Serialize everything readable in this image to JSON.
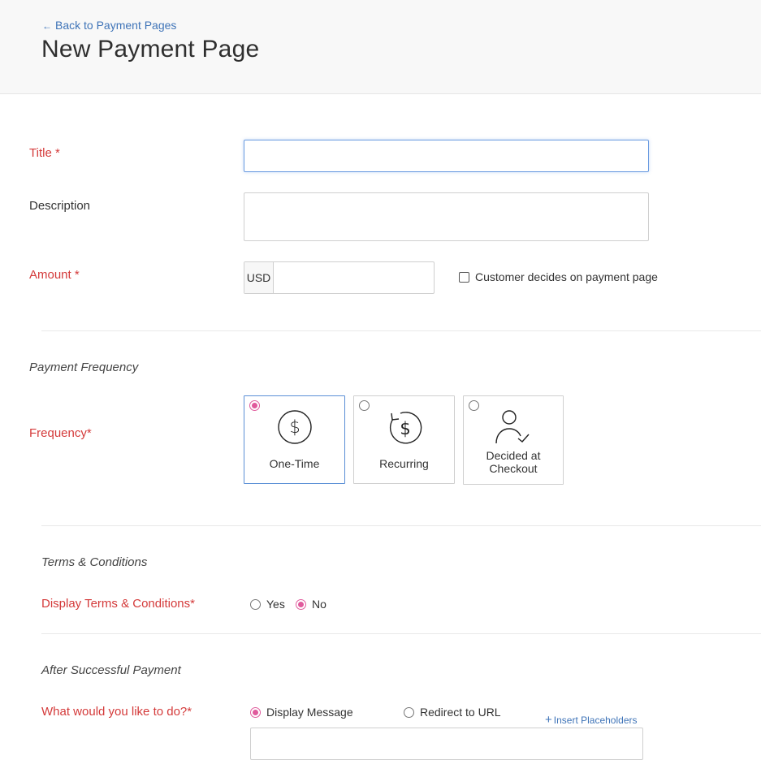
{
  "header": {
    "back_link": "Back to Payment Pages",
    "back_icon": "arrow-left-icon",
    "title": "New Payment Page"
  },
  "form": {
    "title": {
      "label": "Title *",
      "value": "",
      "placeholder": ""
    },
    "description": {
      "label": "Description",
      "value": "",
      "placeholder": ""
    },
    "amount": {
      "label": "Amount *",
      "currency": "USD",
      "value": "",
      "customer_decides_label": "Customer decides on payment page",
      "customer_decides_checked": false
    }
  },
  "payment_frequency": {
    "section_title": "Payment Frequency",
    "label": "Frequency*",
    "options": [
      {
        "label": "One-Time",
        "icon": "dollar-circle-icon",
        "selected": true
      },
      {
        "label": "Recurring",
        "icon": "recurring-dollar-icon",
        "selected": false
      },
      {
        "label": "Decided at Checkout",
        "icon": "user-check-icon",
        "selected": false
      }
    ]
  },
  "terms": {
    "section_title": "Terms & Conditions",
    "label": "Display Terms & Conditions*",
    "options": [
      {
        "label": "Yes",
        "selected": false
      },
      {
        "label": "No",
        "selected": true
      }
    ]
  },
  "after_payment": {
    "section_title": "After Successful Payment",
    "label": "What would you like to do?*",
    "options": [
      {
        "label": "Display Message",
        "selected": true
      },
      {
        "label": "Redirect to URL",
        "selected": false
      }
    ],
    "insert_placeholders": "Insert Placeholders",
    "message_value": ""
  },
  "colors": {
    "required_label": "#d43a3a",
    "link": "#3f74b8",
    "radio_selected": "#e05a9c",
    "card_selected_border": "#5b8fd6"
  }
}
